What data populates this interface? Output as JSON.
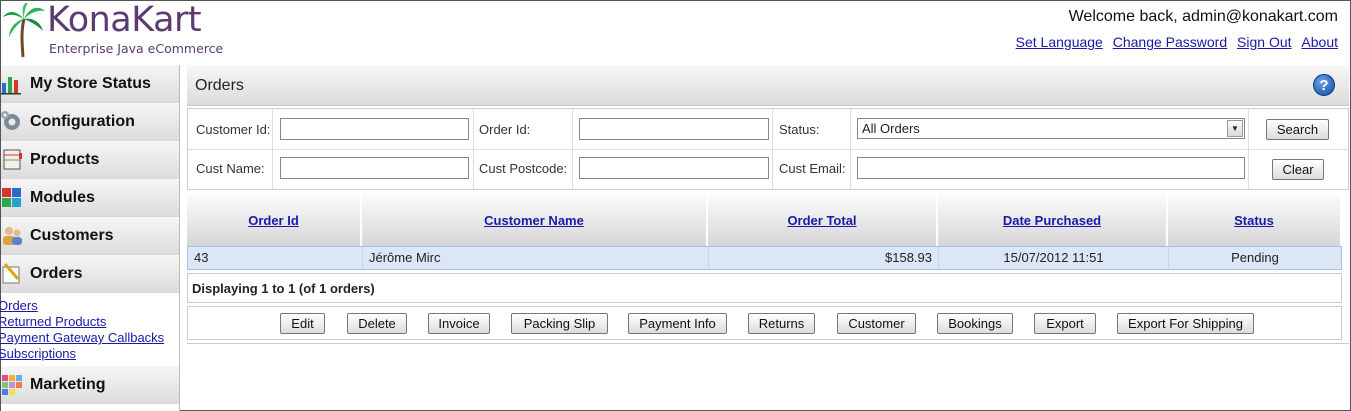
{
  "header": {
    "brand": "KonaKart",
    "tagline": "Enterprise Java eCommerce",
    "welcome": "Welcome back, admin@konakart.com",
    "links": [
      "Set Language",
      "Change Password",
      "Sign Out",
      "About"
    ]
  },
  "sidebar": {
    "items": [
      {
        "label": "My Store Status",
        "icon": "bar-chart-icon"
      },
      {
        "label": "Configuration",
        "icon": "gears-icon"
      },
      {
        "label": "Products",
        "icon": "notebook-icon"
      },
      {
        "label": "Modules",
        "icon": "blocks-icon"
      },
      {
        "label": "Customers",
        "icon": "users-icon"
      },
      {
        "label": "Orders",
        "icon": "pencil-paper-icon"
      },
      {
        "label": "Marketing",
        "icon": "colorful-grid-icon"
      }
    ],
    "orders_sublinks": [
      "Orders",
      "Returned Products",
      "Payment Gateway Callbacks",
      "Subscriptions"
    ]
  },
  "main": {
    "title": "Orders",
    "search": {
      "customer_id_label": "Customer Id:",
      "customer_id_value": "",
      "order_id_label": "Order Id:",
      "order_id_value": "",
      "status_label": "Status:",
      "status_value": "All Orders",
      "cust_name_label": "Cust Name:",
      "cust_name_value": "",
      "cust_postcode_label": "Cust Postcode:",
      "cust_postcode_value": "",
      "cust_email_label": "Cust Email:",
      "cust_email_value": "",
      "search_button": "Search",
      "clear_button": "Clear"
    },
    "table": {
      "columns": [
        "Order Id",
        "Customer Name",
        "Order Total",
        "Date Purchased",
        "Status"
      ],
      "rows": [
        {
          "order_id": "43",
          "customer_name": "Jérôme Mirc",
          "order_total": "$158.93",
          "date_purchased": "15/07/2012 11:51",
          "status": "Pending"
        }
      ],
      "info": "Displaying 1 to 1 (of 1 orders)"
    },
    "actions": [
      "Edit",
      "Delete",
      "Invoice",
      "Packing Slip",
      "Payment Info",
      "Returns",
      "Customer",
      "Bookings",
      "Export",
      "Export For Shipping"
    ]
  },
  "colors": {
    "brand_purple": "#5b3b72",
    "link_blue": "#1a1aa6",
    "row_highlight": "#dbe6f6"
  }
}
